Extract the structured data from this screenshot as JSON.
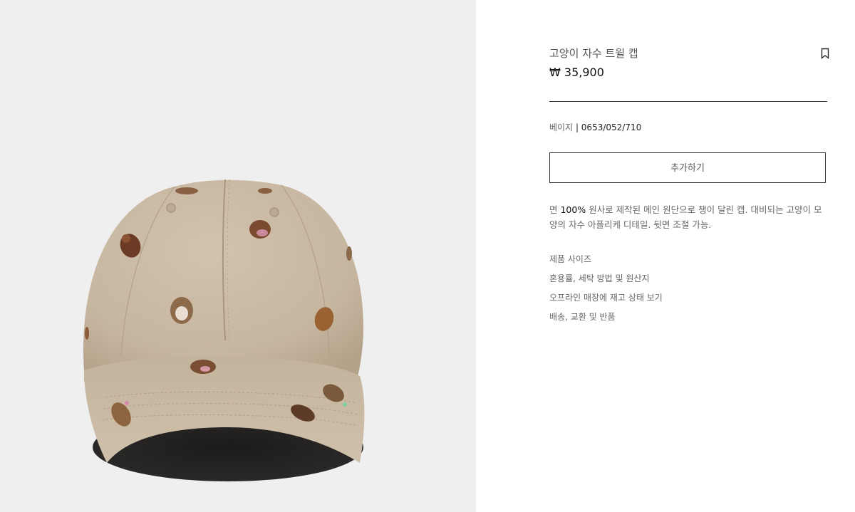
{
  "product": {
    "title": "고양이 자수 트윌 캡",
    "price": "₩ 35,900",
    "color_name": "베이지",
    "separator": " | ",
    "reference": "0653/052/710",
    "add_button_label": "추가하기",
    "description": {
      "before": "면 ",
      "emphasis": "100%",
      "after": " 원사로 제작된 메인 원단으로 챙이 달린 캡. 대비되는 고양이 모양의 자수 아플리케 디테일. 뒷면 조절 가능."
    }
  },
  "info_links": [
    {
      "label": "제품 사이즈"
    },
    {
      "label": "혼용률, 세탁 방법 및 원산지"
    },
    {
      "label": "오프라인 매장에 재고 상태 보기"
    },
    {
      "label": "배송, 교환 및 반품"
    }
  ],
  "icons": {
    "bookmark": "bookmark-icon"
  },
  "colors": {
    "image_background": "#efefef",
    "cap_fabric": "#c9b9a4",
    "text_primary": "#111111",
    "text_secondary": "#666666",
    "border": "#333333"
  }
}
